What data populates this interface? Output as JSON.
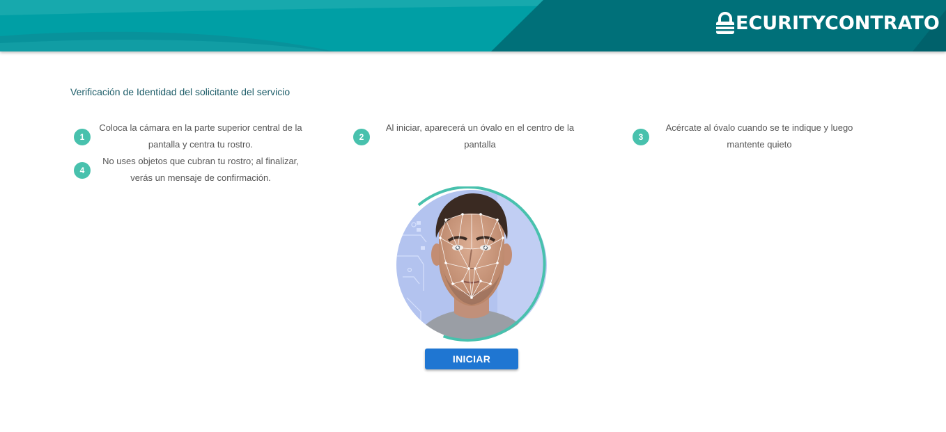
{
  "header": {
    "brand": "ECURITYCONTRATO",
    "brand_icon": "lock-icon",
    "colors": {
      "primary": "#00a0a6",
      "dark": "#006e79",
      "light": "#29b3b4"
    }
  },
  "main": {
    "title": "Verificación de Identidad del solicitante del servicio",
    "steps": [
      {
        "number": "1",
        "text": "Coloca la cámara en la parte superior central de la pantalla y centra tu rostro."
      },
      {
        "number": "2",
        "text": "Al iniciar, aparecerá un óvalo en el centro de la pantalla"
      },
      {
        "number": "3",
        "text": "Acércate al óvalo cuando se te indique y luego mantente quieto"
      },
      {
        "number": "4",
        "text": "No uses objetos que cubran tu rostro; al finalizar, verás un mensaje de confirmación."
      }
    ],
    "camera_icon": "face-scan-illustration",
    "start_button": "INICIAR",
    "colors": {
      "badge": "#48c1ad",
      "button": "#1f76d2",
      "title": "#1c5c68"
    }
  }
}
